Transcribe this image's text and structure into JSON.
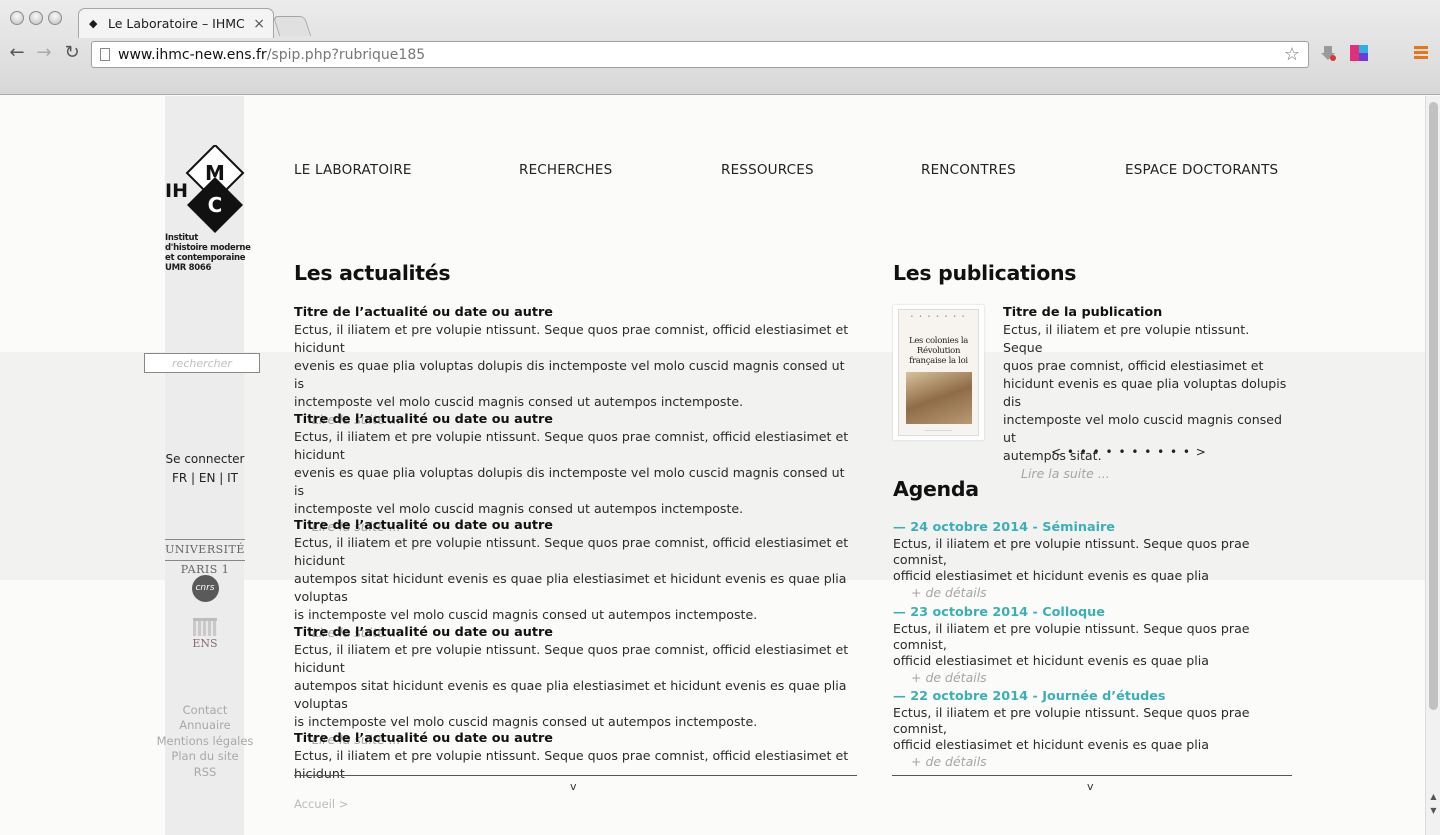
{
  "browser": {
    "tab_title": "Le Laboratoire – IHMC",
    "url_host": "www.ihmc-new.ens.fr",
    "url_path": "/spip.php?rubrique185"
  },
  "logo": {
    "letters": [
      "IH",
      "M",
      "C"
    ],
    "lines": [
      "Institut",
      "d'histoire moderne",
      "et contemporaine",
      "UMR 8066"
    ]
  },
  "search": {
    "placeholder": "rechercher"
  },
  "account": {
    "login": "Se connecter",
    "languages": "FR | EN | IT"
  },
  "partners": {
    "univ": "UNIVERSITÉ PARIS 1",
    "cnrs": "cnrs",
    "ens": "ENS"
  },
  "footer_links": [
    "Contact",
    "Annuaire",
    "Mentions légales",
    "Plan du site",
    "RSS"
  ],
  "nav": [
    "LE LABORATOIRE",
    "RECHERCHES",
    "RESSOURCES",
    "RENCONTRES",
    "ESPACE DOCTORANTS"
  ],
  "news": {
    "heading": "Les actualités",
    "items": [
      {
        "title": "Titre de l’actualité ou date ou autre",
        "lines": [
          "Ectus, il iliatem et pre volupie ntissunt. Seque quos prae comnist, officid elestiasimet et hicidunt",
          "evenis es quae plia voluptas dolupis dis inctemposte vel molo cuscid magnis consed ut is",
          "inctemposte vel molo cuscid magnis consed ut autempos inctemposte."
        ],
        "more": "Lire la suite ..."
      },
      {
        "title": "Titre de l’actualité ou date ou autre",
        "lines": [
          "Ectus, il iliatem et pre volupie ntissunt. Seque quos prae comnist, officid elestiasimet et hicidunt",
          "evenis es quae plia voluptas dolupis dis inctemposte vel molo cuscid magnis consed ut is",
          "inctemposte vel molo cuscid magnis consed ut autempos inctemposte."
        ],
        "more": "Lire la suite ..."
      },
      {
        "title": "Titre de l’actualité ou date ou autre",
        "lines": [
          "Ectus, il iliatem et pre volupie ntissunt. Seque quos prae comnist, officid elestiasimet et hicidunt",
          "autempos sitat hicidunt evenis es quae plia elestiasimet et hicidunt evenis es quae plia voluptas",
          "is inctemposte vel molo cuscid magnis consed ut autempos inctemposte."
        ],
        "more": "Lire la suite ..."
      },
      {
        "title": "Titre de l’actualité ou date ou autre",
        "lines": [
          "Ectus, il iliatem et pre volupie ntissunt. Seque quos prae comnist, officid elestiasimet et hicidunt",
          "autempos sitat hicidunt evenis es quae plia elestiasimet et hicidunt evenis es quae plia voluptas",
          "is inctemposte vel molo cuscid magnis consed ut autempos inctemposte."
        ],
        "more": "Lire la suite ..."
      },
      {
        "title": "Titre de l’actualité ou date ou autre",
        "lines": [
          "Ectus, il iliatem et pre volupie ntissunt. Seque quos prae comnist, officid elestiasimet et hicidunt"
        ]
      }
    ],
    "expand": "v"
  },
  "breadcrumb": "Accueil >",
  "publications": {
    "heading": "Les publications",
    "cover_title": "Les colonies la Révolution française la loi",
    "title": "Titre de la publication",
    "lines": [
      "Ectus, il iliatem et pre volupie ntissunt. Seque",
      "quos prae comnist, officid elestiasimet et",
      "hicidunt evenis es quae plia voluptas dolupis dis",
      "inctemposte vel molo cuscid magnis consed ut",
      "autempos sitat."
    ],
    "more": "Lire la suite ...",
    "pager": "< • • • • • • • • • • >"
  },
  "agenda": {
    "heading": "Agenda",
    "events": [
      {
        "date": "— 24 octobre 2014 - Séminaire",
        "lines": [
          "Ectus, il iliatem et pre volupie ntissunt. Seque quos prae comnist,",
          "officid elestiasimet et hicidunt evenis es quae plia"
        ],
        "more": "+ de détails"
      },
      {
        "date": "— 23 octobre 2014 - Colloque",
        "lines": [
          "Ectus, il iliatem et pre volupie ntissunt. Seque quos prae comnist,",
          "officid elestiasimet et hicidunt evenis es quae plia"
        ],
        "more": "+ de détails"
      },
      {
        "date": "— 22 octobre 2014 - Journée d’études",
        "lines": [
          "Ectus, il iliatem et pre volupie ntissunt. Seque quos prae comnist,",
          "officid elestiasimet et hicidunt evenis es quae plia"
        ],
        "more": "+ de détails"
      }
    ],
    "expand": "v"
  },
  "colors": {
    "accent": "#3ab0b6",
    "sidebar": "#ececec",
    "muted": "#a9a9a9"
  }
}
